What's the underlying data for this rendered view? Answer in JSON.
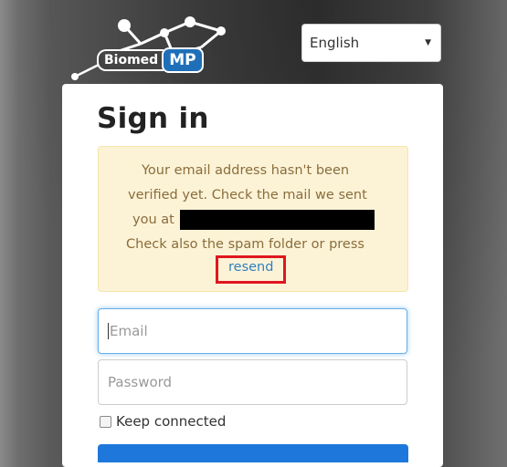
{
  "logo": {
    "part1": "Biomed",
    "part2": "MP"
  },
  "language_select": {
    "value": "English"
  },
  "signin": {
    "title": "Sign in",
    "alert": {
      "line1": "Your email address hasn't been",
      "line2": "verified yet. Check the mail we sent",
      "line3": "you at",
      "line4": "Check also the spam folder or press",
      "resend_label": "resend"
    },
    "email_placeholder": "Email",
    "password_placeholder": "Password",
    "keep_connected_label": "Keep connected"
  },
  "icons": [
    "select-caret-icon",
    "logo-molecule-icon"
  ],
  "colors": {
    "alert_background": "#fcf3d7",
    "alert_text": "#8a6d3b",
    "link": "#2f7fc4",
    "highlight_box": "#e0161e",
    "primary_button": "#1e78dc",
    "focus_border": "#66afe9"
  }
}
